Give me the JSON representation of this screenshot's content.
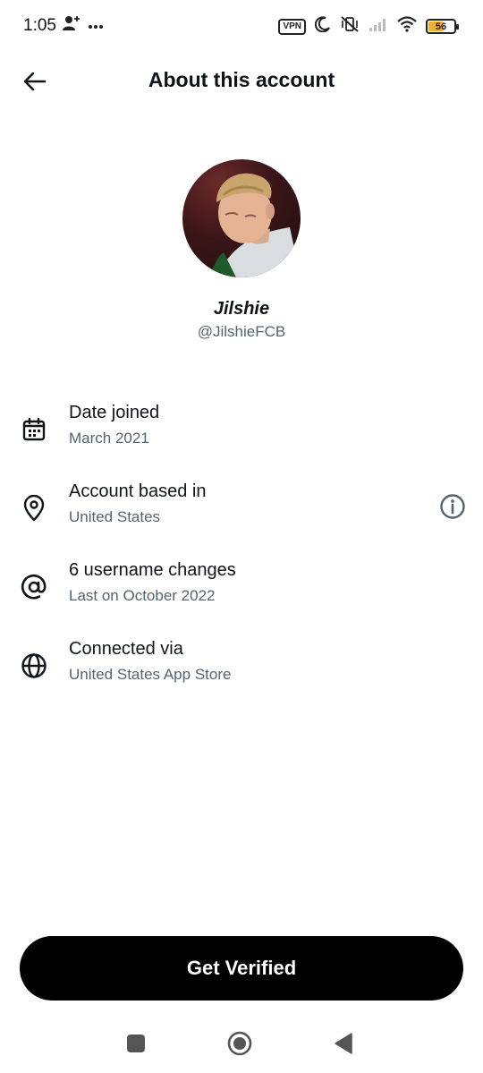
{
  "status_bar": {
    "time": "1:05",
    "vpn_label": "VPN",
    "battery_level": "56",
    "icons": [
      "person-add-icon",
      "more-dots-icon",
      "vpn-icon",
      "moon-icon",
      "vibrate-off-icon",
      "signal-icon",
      "wifi-icon",
      "battery-icon"
    ],
    "battery_color": "#f3b02a"
  },
  "header": {
    "title": "About this account",
    "back_icon": "arrow-left-icon"
  },
  "profile": {
    "display_name": "Jilshie",
    "handle": "@JilshieFCB"
  },
  "info": [
    {
      "icon": "calendar-icon",
      "title": "Date joined",
      "subtitle": "March 2021"
    },
    {
      "icon": "location-pin-icon",
      "title": "Account based in",
      "subtitle": "United States",
      "trailing_icon": "info-circle-icon"
    },
    {
      "icon": "at-sign-icon",
      "title": "6 username changes",
      "subtitle": "Last on October 2022"
    },
    {
      "icon": "globe-icon",
      "title": "Connected via",
      "subtitle": "United States App Store"
    }
  ],
  "cta": {
    "label": "Get Verified"
  },
  "nav": {
    "icons": [
      "square-recents-icon",
      "circle-home-icon",
      "triangle-back-icon"
    ]
  },
  "colors": {
    "text_primary": "#0f1419",
    "text_secondary": "#536471",
    "button_bg": "#000000"
  }
}
